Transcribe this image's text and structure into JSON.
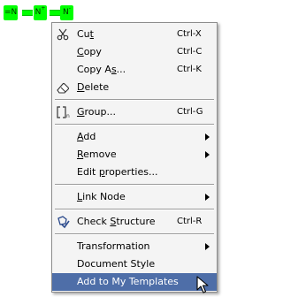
{
  "molecule": {
    "atoms": [
      {
        "symbol": "N",
        "charge": "=",
        "left_text": "="
      },
      {
        "symbol": "N",
        "charge": "+"
      },
      {
        "symbol": "N",
        "charge": "-"
      }
    ]
  },
  "menu": {
    "items": [
      {
        "label_pre": "Cu",
        "label_u": "t",
        "label_post": "",
        "shortcut": "Ctrl-X",
        "icon": "scissors-icon"
      },
      {
        "label_pre": "",
        "label_u": "C",
        "label_post": "opy",
        "shortcut": "Ctrl-C",
        "icon": ""
      },
      {
        "label_pre": "Copy A",
        "label_u": "s",
        "label_post": "...",
        "shortcut": "Ctrl-K",
        "icon": ""
      },
      {
        "label_pre": "",
        "label_u": "D",
        "label_post": "elete",
        "shortcut": "",
        "icon": "eraser-icon"
      },
      {
        "label_pre": "",
        "label_u": "G",
        "label_post": "roup...",
        "shortcut": "Ctrl-G",
        "icon": "group-brackets-icon"
      },
      {
        "label_pre": "",
        "label_u": "A",
        "label_post": "dd",
        "shortcut": "",
        "icon": "",
        "submenu": true
      },
      {
        "label_pre": "",
        "label_u": "R",
        "label_post": "emove",
        "shortcut": "",
        "icon": "",
        "submenu": true
      },
      {
        "label_pre": "Edit ",
        "label_u": "p",
        "label_post": "roperties...",
        "shortcut": "",
        "icon": ""
      },
      {
        "label_pre": "",
        "label_u": "L",
        "label_post": "ink Node",
        "shortcut": "",
        "icon": "",
        "submenu": true
      },
      {
        "label_pre": "Check ",
        "label_u": "S",
        "label_post": "tructure",
        "shortcut": "Ctrl-R",
        "icon": "check-structure-icon"
      },
      {
        "label_pre": "Transformation",
        "label_u": "",
        "label_post": "",
        "shortcut": "",
        "icon": "",
        "submenu": true
      },
      {
        "label_pre": "Document Style",
        "label_u": "",
        "label_post": "",
        "shortcut": "",
        "icon": ""
      },
      {
        "label_pre": "Add to My Templates",
        "label_u": "",
        "label_post": "",
        "shortcut": "",
        "icon": "",
        "active": true
      }
    ]
  },
  "colors": {
    "menu_bg": "#f4f4f4",
    "highlight": "#4e6ea8",
    "atom_highlight": "#00ff00"
  }
}
